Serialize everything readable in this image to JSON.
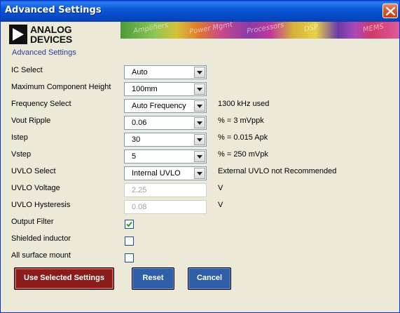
{
  "window": {
    "title": "Advanced Settings",
    "close_icon": "close-icon"
  },
  "header": {
    "logo_line1": "ANALOG",
    "logo_line2": "DEVICES",
    "banner_words": [
      "Amplifiers",
      "Power Mgmt",
      "Processors",
      "DSP",
      "MEMS"
    ],
    "subtitle": "Advanced Settings"
  },
  "form": {
    "ic_select": {
      "label": "IC Select",
      "value": "Auto"
    },
    "max_height": {
      "label": "Maximum Component Height",
      "value": "100mm"
    },
    "freq_select": {
      "label": "Frequency Select",
      "value": "Auto Frequency",
      "note": "1300 kHz used"
    },
    "vout_ripple": {
      "label": "Vout Ripple",
      "value": "0.06",
      "note": "% = 3 mVppk"
    },
    "istep": {
      "label": "Istep",
      "value": "30",
      "note": "% = 0.015 Apk"
    },
    "vstep": {
      "label": "Vstep",
      "value": "5",
      "note": "% = 250 mVpk"
    },
    "uvlo_select": {
      "label": "UVLO Select",
      "value": "Internal UVLO",
      "note": "External UVLO not Recommended"
    },
    "uvlo_voltage": {
      "label": "UVLO Voltage",
      "value": "2.25",
      "unit": "V"
    },
    "uvlo_hysteresis": {
      "label": "UVLO Hysteresis",
      "value": "0.08",
      "unit": "V"
    },
    "output_filter": {
      "label": "Output Filter",
      "checked": true
    },
    "shielded_inductor": {
      "label": "Shielded inductor",
      "checked": false
    },
    "surface_mount": {
      "label": "All surface mount",
      "checked": false
    }
  },
  "buttons": {
    "use_selected": "Use Selected Settings",
    "reset": "Reset",
    "cancel": "Cancel"
  },
  "colors": {
    "title_bar": "#0a58d8",
    "primary_button": "#8a1c1c",
    "secondary_button": "#2e5fa8"
  }
}
